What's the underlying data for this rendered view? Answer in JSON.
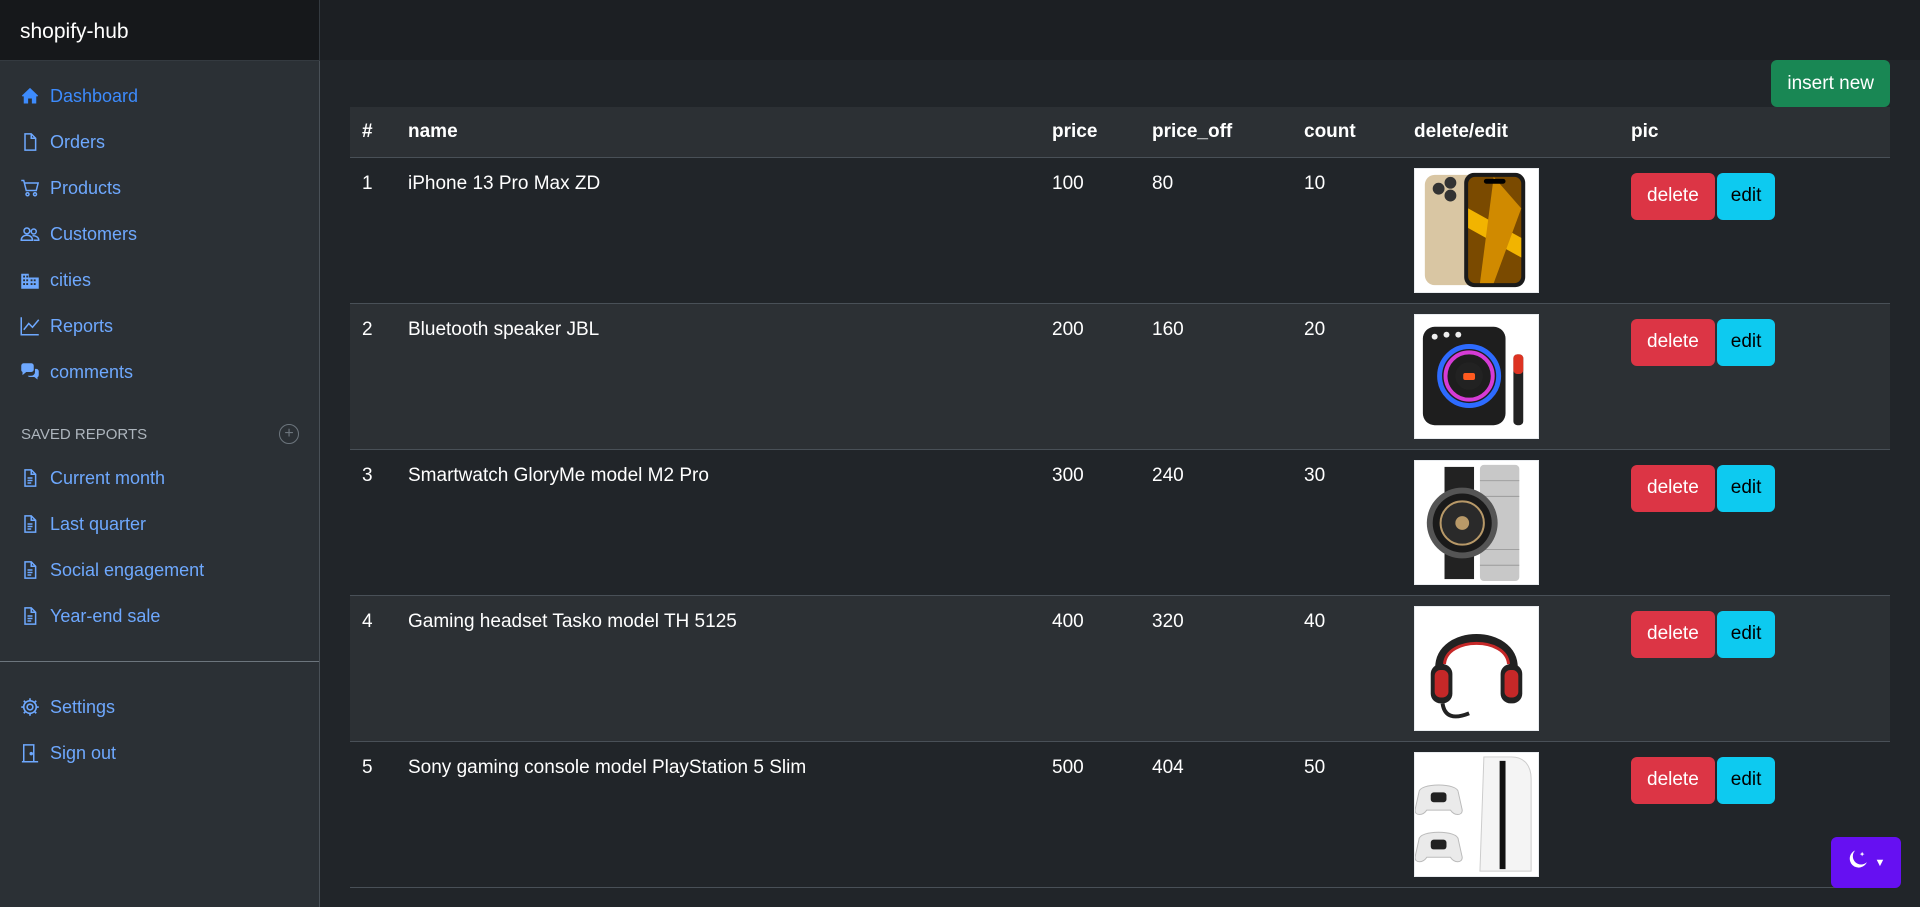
{
  "app": {
    "brand": "shopify-hub"
  },
  "sidebar": {
    "items": [
      {
        "label": "Dashboard",
        "icon": "house-icon",
        "active": true
      },
      {
        "label": "Orders",
        "icon": "file-icon"
      },
      {
        "label": "Products",
        "icon": "cart-icon"
      },
      {
        "label": "Customers",
        "icon": "people-icon"
      },
      {
        "label": "cities",
        "icon": "buildings-icon"
      },
      {
        "label": "Reports",
        "icon": "graph-icon"
      },
      {
        "label": "comments",
        "icon": "chat-icon"
      }
    ],
    "saved_heading": "Saved reports",
    "saved": [
      {
        "label": "Current month",
        "icon": "file-text-icon"
      },
      {
        "label": "Last quarter",
        "icon": "file-text-icon"
      },
      {
        "label": "Social engagement",
        "icon": "file-text-icon"
      },
      {
        "label": "Year-end sale",
        "icon": "file-text-icon"
      }
    ],
    "bottom": [
      {
        "label": "Settings",
        "icon": "gear-icon"
      },
      {
        "label": "Sign out",
        "icon": "door-icon"
      }
    ]
  },
  "toolbar": {
    "insert_label": "insert new"
  },
  "table": {
    "headers": [
      "#",
      "name",
      "price",
      "price_off",
      "count",
      "delete/edit",
      "pic"
    ],
    "rows": [
      {
        "id": "1",
        "name": "iPhone 13 Pro Max ZD",
        "price": "100",
        "price_off": "80",
        "count": "10",
        "pic": "phone"
      },
      {
        "id": "2",
        "name": "Bluetooth speaker JBL",
        "price": "200",
        "price_off": "160",
        "count": "20",
        "pic": "speaker"
      },
      {
        "id": "3",
        "name": "Smartwatch GloryMe model M2 Pro",
        "price": "300",
        "price_off": "240",
        "count": "30",
        "pic": "watch"
      },
      {
        "id": "4",
        "name": "Gaming headset Tasko model TH 5125",
        "price": "400",
        "price_off": "320",
        "count": "40",
        "pic": "headset"
      },
      {
        "id": "5",
        "name": "Sony gaming console model PlayStation 5 Slim",
        "price": "500",
        "price_off": "404",
        "count": "50",
        "pic": "console"
      }
    ],
    "delete_label": "delete",
    "edit_label": "edit"
  },
  "colors": {
    "accent": "#6ea8fe",
    "success": "#198754",
    "danger": "#dc3545",
    "info": "#0dcaf0",
    "theme": "#6610f2"
  }
}
